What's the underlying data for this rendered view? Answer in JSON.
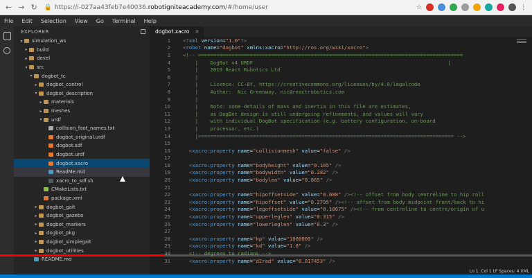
{
  "browser": {
    "url_prefix": "https://i-027aa43feb7e40036.",
    "url_domain": "robotigniteacademy.com",
    "url_suffix": "/#/home/user"
  },
  "menu": [
    "File",
    "Edit",
    "Selection",
    "View",
    "Go",
    "Terminal",
    "Help"
  ],
  "explorer": {
    "title": "EXPLORER",
    "items": [
      {
        "label": "simulation_ws",
        "depth": 1,
        "kind": "folder",
        "open": true
      },
      {
        "label": "build",
        "depth": 2,
        "kind": "folder",
        "open": false
      },
      {
        "label": "devel",
        "depth": 2,
        "kind": "folder",
        "open": false
      },
      {
        "label": "src",
        "depth": 2,
        "kind": "folder",
        "open": true
      },
      {
        "label": "dogbot_tc",
        "depth": 3,
        "kind": "folder",
        "open": true
      },
      {
        "label": "dogbot_control",
        "depth": 4,
        "kind": "folder",
        "open": false
      },
      {
        "label": "dogbot_description",
        "depth": 4,
        "kind": "folder",
        "open": true
      },
      {
        "label": "materials",
        "depth": 5,
        "kind": "folder",
        "open": false
      },
      {
        "label": "meshes",
        "depth": 5,
        "kind": "folder",
        "open": false
      },
      {
        "label": "urdf",
        "depth": 5,
        "kind": "folder",
        "open": true
      },
      {
        "label": "collision_foot_names.txt",
        "depth": 6,
        "kind": "txt"
      },
      {
        "label": "dogbot_original.urdf",
        "depth": 6,
        "kind": "xml"
      },
      {
        "label": "dogbot.sdf",
        "depth": 6,
        "kind": "xml"
      },
      {
        "label": "dogbot.urdf",
        "depth": 6,
        "kind": "xml"
      },
      {
        "label": "dogbot.xacro",
        "depth": 6,
        "kind": "xml",
        "selected": true
      },
      {
        "label": "ReadMe.md",
        "depth": 6,
        "kind": "md",
        "active": true
      },
      {
        "label": "xacro_to_sdf.sh",
        "depth": 6,
        "kind": "sh"
      },
      {
        "label": "CMakeLists.txt",
        "depth": 5,
        "kind": "cmake"
      },
      {
        "label": "package.xml",
        "depth": 5,
        "kind": "xml"
      },
      {
        "label": "dogbot_gait",
        "depth": 4,
        "kind": "folder",
        "open": false
      },
      {
        "label": "dogbot_gazebo",
        "depth": 4,
        "kind": "folder",
        "open": false
      },
      {
        "label": "dogbot_markers",
        "depth": 4,
        "kind": "folder",
        "open": false
      },
      {
        "label": "dogbot_pkg",
        "depth": 4,
        "kind": "folder",
        "open": false
      },
      {
        "label": "dogbot_simplegait",
        "depth": 4,
        "kind": "folder",
        "open": false
      },
      {
        "label": "dogbot_utilities",
        "depth": 4,
        "kind": "folder",
        "open": false
      },
      {
        "label": "README.md",
        "depth": 3,
        "kind": "md"
      }
    ]
  },
  "editor": {
    "tab_label": "dogbot.xacro",
    "lines": [
      {
        "n": "1",
        "parts": [
          [
            "c-pi",
            "<?"
          ],
          [
            "c-tag",
            "xml"
          ],
          [
            "c-attr",
            " version"
          ],
          [
            "c-def",
            "="
          ],
          [
            "c-str",
            "\"1.0\""
          ],
          [
            "c-pi",
            "?>"
          ]
        ]
      },
      {
        "n": "2",
        "parts": [
          [
            "c-pi",
            "<"
          ],
          [
            "c-tag",
            "robot"
          ],
          [
            "c-attr",
            " name"
          ],
          [
            "c-def",
            "="
          ],
          [
            "c-str",
            "\"dogbot\""
          ],
          [
            "c-attr",
            " xmlns:xacro"
          ],
          [
            "c-def",
            "="
          ],
          [
            "c-str",
            "\"http://ros.org/wiki/xacro\""
          ],
          [
            "c-pi",
            ">"
          ]
        ]
      },
      {
        "n": "3",
        "parts": [
          [
            "c-com",
            "<!-- ======================================================================================="
          ]
        ]
      },
      {
        "n": "4",
        "parts": [
          [
            "c-com",
            "    |    DogBot v4 URDF                                                                |"
          ]
        ]
      },
      {
        "n": "5",
        "parts": [
          [
            "c-com",
            "    |    2019 React Robotics Ltd"
          ]
        ]
      },
      {
        "n": "6",
        "parts": [
          [
            "c-com",
            "    |"
          ]
        ]
      },
      {
        "n": "7",
        "parts": [
          [
            "c-com",
            "    |    Licence: CC-BY, https://creativecommons.org/licenses/by/4.0/legalcode"
          ]
        ]
      },
      {
        "n": "8",
        "parts": [
          [
            "c-com",
            "    |    Author:  Nic Greenway, nic@reactrobotics.com"
          ]
        ]
      },
      {
        "n": "9",
        "parts": [
          [
            "c-com",
            "    |"
          ]
        ]
      },
      {
        "n": "10",
        "parts": [
          [
            "c-com",
            "    |    Note: some details of mass and inertia in this file are estimates,"
          ]
        ]
      },
      {
        "n": "11",
        "parts": [
          [
            "c-com",
            "    |    as DogBot design is still undergoing refinements, and values will vary"
          ]
        ]
      },
      {
        "n": "12",
        "parts": [
          [
            "c-com",
            "    |    with individual DogBot specification (e.g. battery configuration, on-board"
          ]
        ]
      },
      {
        "n": "13",
        "parts": [
          [
            "c-com",
            "    |    processor, etc.)"
          ]
        ]
      },
      {
        "n": "14",
        "parts": [
          [
            "c-com",
            "    |==================================================================================== -->"
          ]
        ]
      },
      {
        "n": "15",
        "parts": [
          [
            "c-def",
            ""
          ]
        ]
      },
      {
        "n": "16",
        "parts": [
          [
            "c-pi",
            "  <"
          ],
          [
            "c-tag",
            "xacro:property"
          ],
          [
            "c-attr",
            " name"
          ],
          [
            "c-def",
            "="
          ],
          [
            "c-str",
            "\"collisionmesh\""
          ],
          [
            "c-attr",
            " value"
          ],
          [
            "c-def",
            "="
          ],
          [
            "c-str",
            "\"false\""
          ],
          [
            "c-pi",
            " />"
          ]
        ]
      },
      {
        "n": "17",
        "parts": [
          [
            "c-def",
            ""
          ]
        ]
      },
      {
        "n": "18",
        "parts": [
          [
            "c-pi",
            "  <"
          ],
          [
            "c-tag",
            "xacro:property"
          ],
          [
            "c-attr",
            " name"
          ],
          [
            "c-def",
            "="
          ],
          [
            "c-str",
            "\"bodyheight\""
          ],
          [
            "c-attr",
            " value"
          ],
          [
            "c-def",
            "="
          ],
          [
            "c-str",
            "\"0.105\""
          ],
          [
            "c-pi",
            " />"
          ]
        ]
      },
      {
        "n": "19",
        "parts": [
          [
            "c-pi",
            "  <"
          ],
          [
            "c-tag",
            "xacro:property"
          ],
          [
            "c-attr",
            " name"
          ],
          [
            "c-def",
            "="
          ],
          [
            "c-str",
            "\"bodywidth\""
          ],
          [
            "c-attr",
            " value"
          ],
          [
            "c-def",
            "="
          ],
          [
            "c-str",
            "\"0.282\""
          ],
          [
            "c-pi",
            " />"
          ]
        ]
      },
      {
        "n": "20",
        "parts": [
          [
            "c-pi",
            "  <"
          ],
          [
            "c-tag",
            "xacro:property"
          ],
          [
            "c-attr",
            " name"
          ],
          [
            "c-def",
            "="
          ],
          [
            "c-str",
            "\"bodylen\""
          ],
          [
            "c-attr",
            " value"
          ],
          [
            "c-def",
            "="
          ],
          [
            "c-str",
            "\"0.865\""
          ],
          [
            "c-pi",
            " />"
          ]
        ]
      },
      {
        "n": "21",
        "parts": [
          [
            "c-def",
            ""
          ]
        ]
      },
      {
        "n": "22",
        "parts": [
          [
            "c-pi",
            "  <"
          ],
          [
            "c-tag",
            "xacro:property"
          ],
          [
            "c-attr",
            " name"
          ],
          [
            "c-def",
            "="
          ],
          [
            "c-str",
            "\"hipoffsetside\""
          ],
          [
            "c-attr",
            " value"
          ],
          [
            "c-def",
            "="
          ],
          [
            "c-str",
            "\"0.088\""
          ],
          [
            "c-pi",
            " />"
          ],
          [
            "c-com",
            "<!-- offset from body centreline to hip roll"
          ]
        ]
      },
      {
        "n": "23",
        "parts": [
          [
            "c-pi",
            "  <"
          ],
          [
            "c-tag",
            "xacro:property"
          ],
          [
            "c-attr",
            " name"
          ],
          [
            "c-def",
            "="
          ],
          [
            "c-str",
            "\"hipoffset\""
          ],
          [
            "c-attr",
            " value"
          ],
          [
            "c-def",
            "="
          ],
          [
            "c-str",
            "\"0.2795\""
          ],
          [
            "c-pi",
            " />"
          ],
          [
            "c-com",
            "<!-- offset from body midpoint front/back to hi"
          ]
        ]
      },
      {
        "n": "24",
        "parts": [
          [
            "c-pi",
            "  <"
          ],
          [
            "c-tag",
            "xacro:property"
          ],
          [
            "c-attr",
            " name"
          ],
          [
            "c-def",
            "="
          ],
          [
            "c-str",
            "\"legoffsetside\""
          ],
          [
            "c-attr",
            " value"
          ],
          [
            "c-def",
            "="
          ],
          [
            "c-str",
            "\"0.18675\""
          ],
          [
            "c-pi",
            " />"
          ],
          [
            "c-com",
            "<!-- from centreline to centre/origin of u"
          ]
        ]
      },
      {
        "n": "25",
        "parts": [
          [
            "c-pi",
            "  <"
          ],
          [
            "c-tag",
            "xacro:property"
          ],
          [
            "c-attr",
            " name"
          ],
          [
            "c-def",
            "="
          ],
          [
            "c-str",
            "\"upperleglen\""
          ],
          [
            "c-attr",
            " value"
          ],
          [
            "c-def",
            "="
          ],
          [
            "c-str",
            "\"0.315\""
          ],
          [
            "c-pi",
            " />"
          ]
        ]
      },
      {
        "n": "26",
        "parts": [
          [
            "c-pi",
            "  <"
          ],
          [
            "c-tag",
            "xacro:property"
          ],
          [
            "c-attr",
            " name"
          ],
          [
            "c-def",
            "="
          ],
          [
            "c-str",
            "\"lowerleglen\""
          ],
          [
            "c-attr",
            " value"
          ],
          [
            "c-def",
            "="
          ],
          [
            "c-str",
            "\"0.3\""
          ],
          [
            "c-pi",
            " />"
          ]
        ]
      },
      {
        "n": "27",
        "parts": [
          [
            "c-def",
            ""
          ]
        ]
      },
      {
        "n": "28",
        "parts": [
          [
            "c-pi",
            "  <"
          ],
          [
            "c-tag",
            "xacro:property"
          ],
          [
            "c-attr",
            " name"
          ],
          [
            "c-def",
            "="
          ],
          [
            "c-str",
            "\"kp\""
          ],
          [
            "c-attr",
            " value"
          ],
          [
            "c-def",
            "="
          ],
          [
            "c-str",
            "\"1000000\""
          ],
          [
            "c-pi",
            " />"
          ]
        ]
      },
      {
        "n": "29",
        "parts": [
          [
            "c-pi",
            "  <"
          ],
          [
            "c-tag",
            "xacro:property"
          ],
          [
            "c-attr",
            " name"
          ],
          [
            "c-def",
            "="
          ],
          [
            "c-str",
            "\"kd\""
          ],
          [
            "c-attr",
            " value"
          ],
          [
            "c-def",
            "="
          ],
          [
            "c-str",
            "\"1.0\""
          ],
          [
            "c-pi",
            " />"
          ]
        ]
      },
      {
        "n": "30",
        "parts": [
          [
            "c-com",
            "  <!-- degrees to radians -->"
          ]
        ]
      },
      {
        "n": "31",
        "parts": [
          [
            "c-pi",
            "  <"
          ],
          [
            "c-tag",
            "xacro:property"
          ],
          [
            "c-attr",
            " name"
          ],
          [
            "c-def",
            "="
          ],
          [
            "c-str",
            "\"d2rad\""
          ],
          [
            "c-attr",
            " value"
          ],
          [
            "c-def",
            "="
          ],
          [
            "c-str",
            "\"0.017453\""
          ],
          [
            "c-pi",
            " />"
          ]
        ]
      }
    ]
  },
  "status_text": "Ln 1, Col 1   LF   Spaces: 4   XML",
  "video_progress": 0.31,
  "colors": {
    "accent": "#007acc",
    "progress": "#ff0000"
  }
}
